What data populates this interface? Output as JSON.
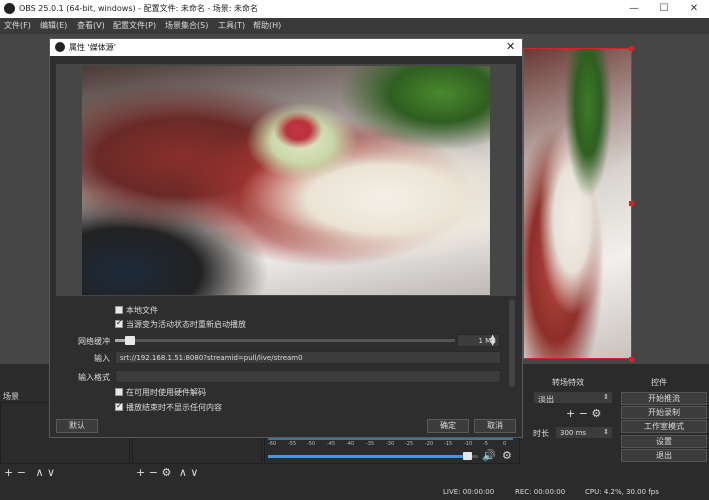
{
  "window": {
    "title": "OBS 25.0.1 (64-bit, windows) - 配置文件: 未命名 - 场景: 未命名"
  },
  "menubar": [
    "文件(F)",
    "编辑(E)",
    "查看(V)",
    "配置文件(P)",
    "场景集合(S)",
    "工具(T)",
    "帮助(H)"
  ],
  "docks": {
    "scenes_title": "场景",
    "transitions_title": "转场特效",
    "transition_select": "淡出",
    "duration_label": "时长",
    "duration_value": "300 ms",
    "controls_title": "控件",
    "controls": [
      "开始推流",
      "开始录制",
      "工作室模式",
      "设置",
      "退出"
    ]
  },
  "mixer": {
    "ticks": [
      "-60",
      "-55",
      "-50",
      "-45",
      "-40",
      "-35",
      "-30",
      "-25",
      "-20",
      "-15",
      "-10",
      "-5",
      "0"
    ],
    "volume_fraction": 0.97
  },
  "statusbar": {
    "live": "LIVE: 00:00:00",
    "rec": "REC: 00:00:00",
    "cpu": "CPU: 4.2%, 30.00 fps"
  },
  "dialog": {
    "title": "属性 '媒体源'",
    "local_file_label": "本地文件",
    "local_file_checked": false,
    "restart_label": "当源变为活动状态时重新启动播放",
    "restart_checked": true,
    "buffer_label": "网络缓冲",
    "buffer_value": "1 MB",
    "buffer_fraction": 0.03,
    "input_label": "输入",
    "input_value": "srt://192.168.1.51:8080?streamid=pull/live/stream0",
    "input_format_label": "输入格式",
    "input_format_value": "",
    "hw_decode_label": "在可用时使用硬件解码",
    "hw_decode_checked": false,
    "hide_on_end_label": "播放结束时不显示任何内容",
    "hide_on_end_checked": true,
    "defaults_button": "默认",
    "ok_button": "确定",
    "cancel_button": "取消"
  },
  "icons": {
    "close": "close-icon",
    "minimize": "minimize-icon",
    "maximize": "maximize-icon",
    "gear": "gear-icon",
    "speaker": "speaker-icon"
  },
  "colors": {
    "selection": "#e02020",
    "meter": "#3a9adf",
    "window_bg": "#2b2b2b"
  }
}
